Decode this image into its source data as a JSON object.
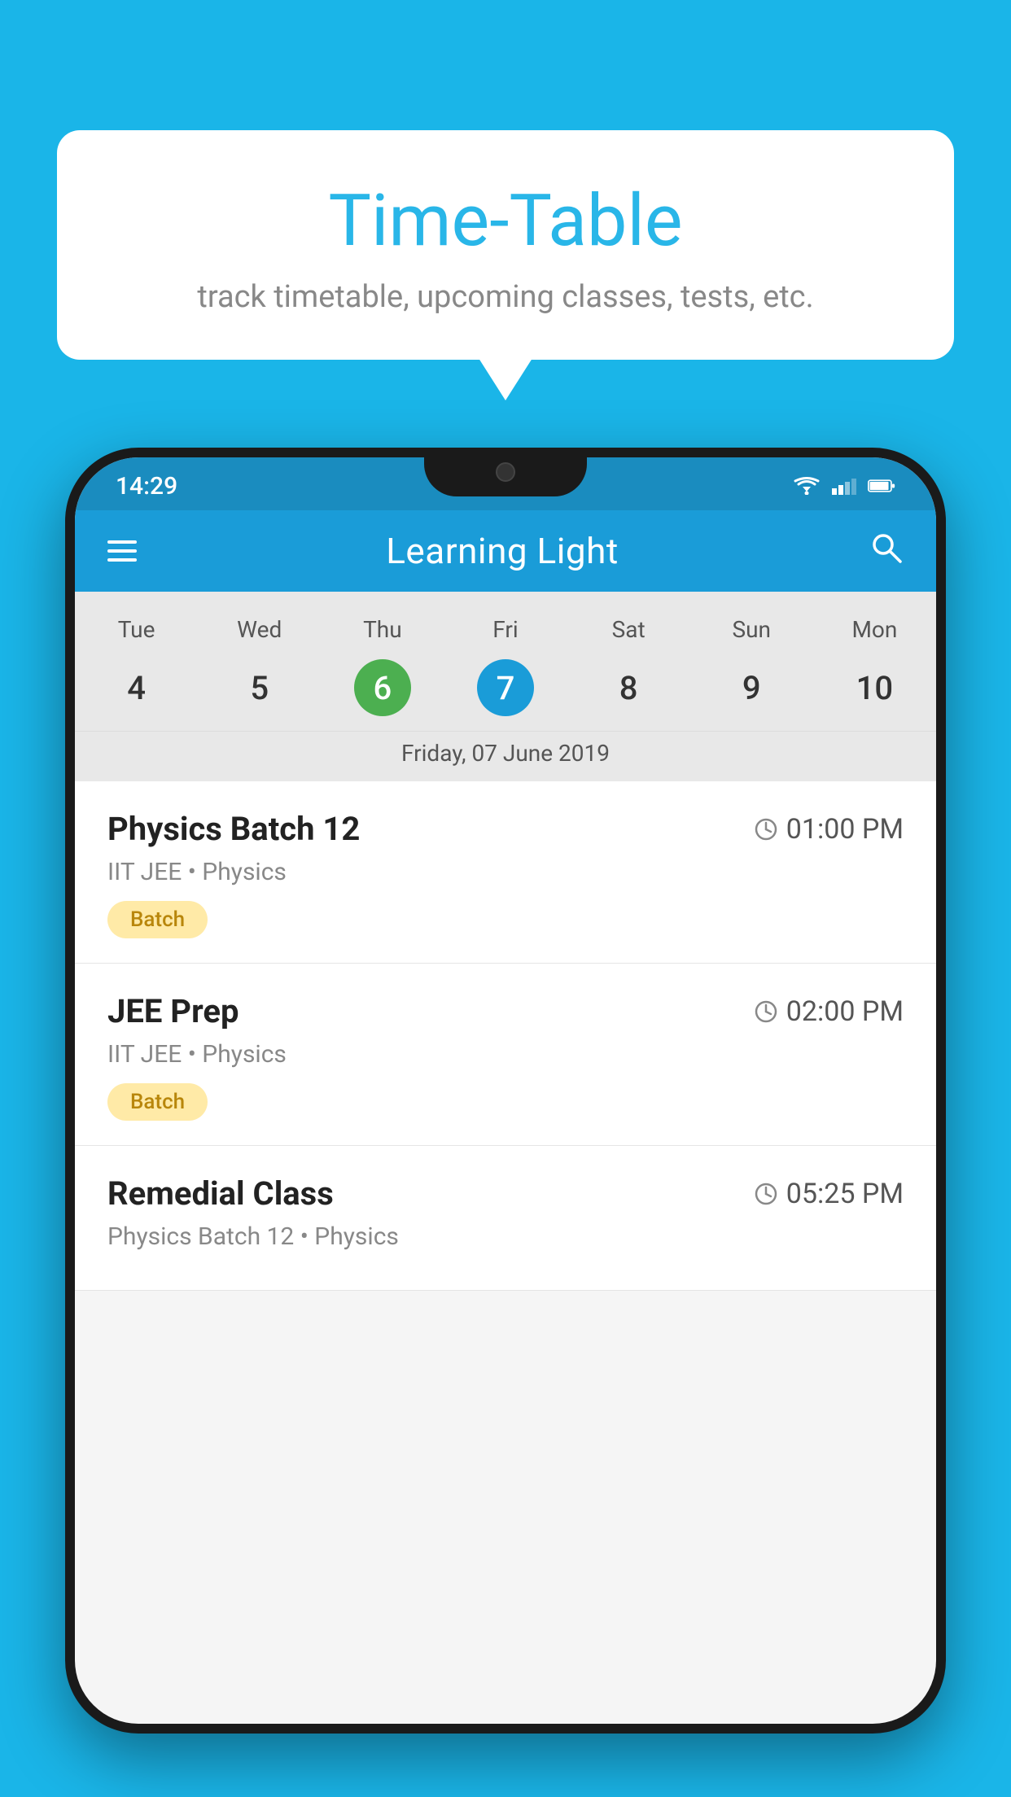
{
  "background": {
    "color": "#1ab5e8"
  },
  "speechBubble": {
    "title": "Time-Table",
    "subtitle": "track timetable, upcoming classes, tests, etc."
  },
  "phone": {
    "statusBar": {
      "time": "14:29"
    },
    "header": {
      "title": "Learning Light",
      "hamburger_label": "menu",
      "search_label": "search"
    },
    "calendar": {
      "days": [
        {
          "label": "Tue",
          "number": "4"
        },
        {
          "label": "Wed",
          "number": "5"
        },
        {
          "label": "Thu",
          "number": "6",
          "state": "today"
        },
        {
          "label": "Fri",
          "number": "7",
          "state": "selected"
        },
        {
          "label": "Sat",
          "number": "8"
        },
        {
          "label": "Sun",
          "number": "9"
        },
        {
          "label": "Mon",
          "number": "10"
        }
      ],
      "selectedDate": "Friday, 07 June 2019"
    },
    "schedule": [
      {
        "title": "Physics Batch 12",
        "time": "01:00 PM",
        "subtitle": "IIT JEE • Physics",
        "badge": "Batch"
      },
      {
        "title": "JEE Prep",
        "time": "02:00 PM",
        "subtitle": "IIT JEE • Physics",
        "badge": "Batch"
      },
      {
        "title": "Remedial Class",
        "time": "05:25 PM",
        "subtitle": "Physics Batch 12 • Physics",
        "badge": ""
      }
    ]
  }
}
